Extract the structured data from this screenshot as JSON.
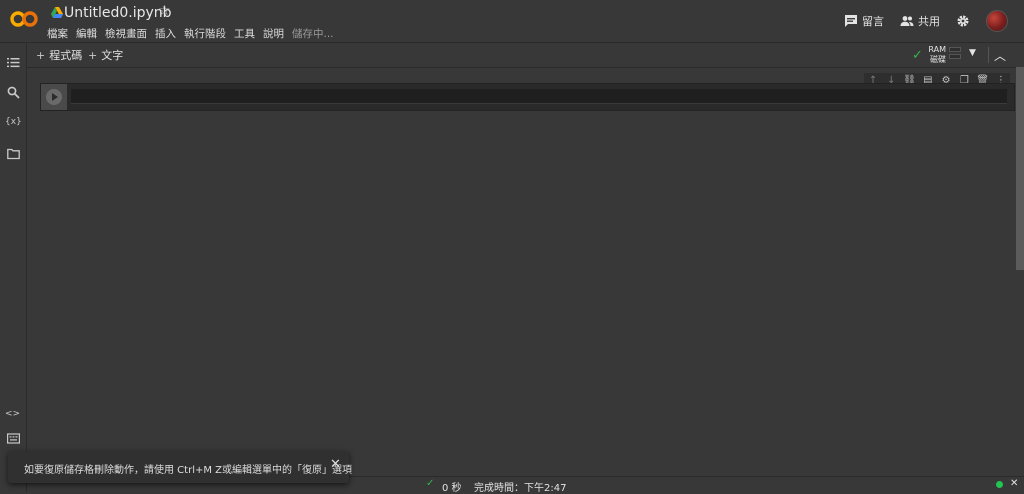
{
  "header": {
    "title": "Untitled0.ipynb",
    "star_icon": "star-outline-icon",
    "menu": [
      "檔案",
      "編輯",
      "檢視畫面",
      "插入",
      "執行階段",
      "工具",
      "說明"
    ],
    "saving": "儲存中...",
    "comment_label": "留言",
    "share_label": "共用"
  },
  "toolbar": {
    "add_code": "程式碼",
    "add_text": "文字",
    "ram_label": "RAM",
    "disk_label": "磁碟"
  },
  "sidebar": {
    "icons": [
      "toc-icon",
      "search-icon",
      "variables-icon",
      "folder-icon",
      "code-snippets-icon",
      "terminal-icon"
    ],
    "variables_text": "{x}",
    "snippets_text": "<>"
  },
  "status": {
    "elapsed": "0 秒",
    "completed": "完成時間：下午2:47"
  },
  "snackbar": {
    "message": "如要復原儲存格刪除動作，請使用 Ctrl+M Z或編輯選單中的「復原」選項"
  },
  "colors": {
    "background": "#383838",
    "accent_green": "#38b44a",
    "logo_orange": "#f9ab00"
  }
}
